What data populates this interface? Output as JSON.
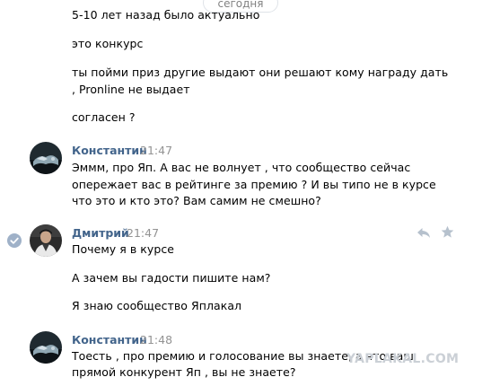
{
  "date_divider": "сегодня",
  "first_block": {
    "lines": [
      "5-10 лет назад было актуально",
      "это конкурс",
      "ты пойми приз другие выдают они решают кому награду дать",
      ", Pronline не выдает",
      "согласен ?"
    ]
  },
  "messages": [
    {
      "author": "Константин",
      "time": "21:47",
      "lines": [
        "Эммм, про Яп. А вас не волнует , что сообщество сейчас",
        "опережает вас в рейтинге за премию ? И вы типо не в курсе",
        "что это и кто это? Вам самим не смешно?"
      ]
    },
    {
      "author": "Дмитрий",
      "time": "21:47",
      "lines": [
        "Почему я в курсе",
        "А зачем вы гадости пишите нам?",
        "Я знаю сообщество Яплакал"
      ]
    },
    {
      "author": "Константин",
      "time": "21:48",
      "lines": [
        "Тоесть , про премию и голосование вы знаете, а что ваш",
        "прямой конкурент Яп , вы не знаете?"
      ]
    }
  ],
  "watermark": "YAPLAKAL.COM",
  "colors": {
    "author": "#42648b",
    "time": "#939393",
    "text": "#000000",
    "check": "#9fb1c8",
    "action_icons": "#b6c1cd"
  },
  "icons": [
    "check-icon",
    "reply-icon",
    "star-icon"
  ]
}
